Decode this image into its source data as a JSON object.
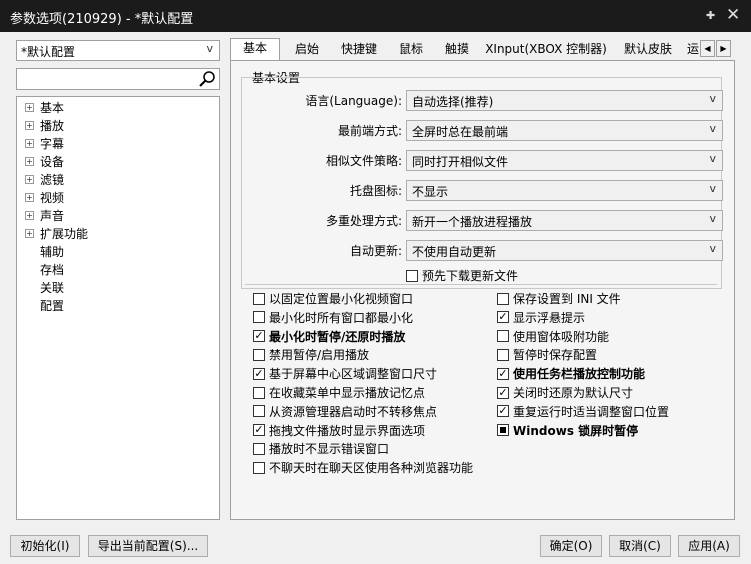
{
  "window": {
    "title": "参数选项(210929) - *默认配置",
    "pin_icon": "pin-icon",
    "close_icon": "close-icon"
  },
  "left_panel": {
    "preset_value": "*默认配置",
    "search_placeholder": "",
    "tree": [
      {
        "label": "基本",
        "expandable": true
      },
      {
        "label": "播放",
        "expandable": true
      },
      {
        "label": "字幕",
        "expandable": true
      },
      {
        "label": "设备",
        "expandable": true
      },
      {
        "label": "滤镜",
        "expandable": true
      },
      {
        "label": "视频",
        "expandable": true
      },
      {
        "label": "声音",
        "expandable": true
      },
      {
        "label": "扩展功能",
        "expandable": true
      },
      {
        "label": "辅助",
        "expandable": false
      },
      {
        "label": "存档",
        "expandable": false
      },
      {
        "label": "关联",
        "expandable": false
      },
      {
        "label": "配置",
        "expandable": false
      }
    ]
  },
  "tabs": [
    "基本",
    "启始",
    "快捷键",
    "鼠标",
    "触摸",
    "XInput(XBOX 控制器)",
    "默认皮肤",
    "运"
  ],
  "active_tab": 0,
  "basic": {
    "group_label": "基本设置",
    "rows": [
      {
        "label": "语言(Language):",
        "value": "自动选择(推荐)"
      },
      {
        "label": "最前端方式:",
        "value": "全屏时总在最前端"
      },
      {
        "label": "相似文件策略:",
        "value": "同时打开相似文件"
      },
      {
        "label": "托盘图标:",
        "value": "不显示"
      },
      {
        "label": "多重处理方式:",
        "value": "新开一个播放进程播放"
      },
      {
        "label": "自动更新:",
        "value": "不使用自动更新"
      }
    ],
    "predownload": {
      "label": "预先下载更新文件",
      "checked": false
    }
  },
  "options_left": [
    {
      "label": "以固定位置最小化视频窗口",
      "checked": false,
      "bold": false
    },
    {
      "label": "最小化时所有窗口都最小化",
      "checked": false,
      "bold": false
    },
    {
      "label": "最小化时暂停/还原时播放",
      "checked": true,
      "bold": true
    },
    {
      "label": "禁用暂停/启用播放",
      "checked": false,
      "bold": false
    },
    {
      "label": "基于屏幕中心区域调整窗口尺寸",
      "checked": true,
      "bold": false
    },
    {
      "label": "在收藏菜单中显示播放记忆点",
      "checked": false,
      "bold": false
    },
    {
      "label": "从资源管理器启动时不转移焦点",
      "checked": false,
      "bold": false
    },
    {
      "label": "拖拽文件播放时显示界面选项",
      "checked": true,
      "bold": false
    },
    {
      "label": "播放时不显示错误窗口",
      "checked": false,
      "bold": false
    },
    {
      "label": "不聊天时在聊天区使用各种浏览器功能",
      "checked": false,
      "bold": false
    }
  ],
  "options_right": [
    {
      "label": "保存设置到 INI 文件",
      "state": "unchecked",
      "bold": false
    },
    {
      "label": "显示浮悬提示",
      "state": "checked",
      "bold": false
    },
    {
      "label": "使用窗体吸附功能",
      "state": "unchecked",
      "bold": false
    },
    {
      "label": "暂停时保存配置",
      "state": "unchecked",
      "bold": false
    },
    {
      "label": "使用任务栏播放控制功能",
      "state": "checked",
      "bold": true
    },
    {
      "label": "关闭时还原为默认尺寸",
      "state": "checked",
      "bold": false
    },
    {
      "label": "重复运行时适当调整窗口位置",
      "state": "checked",
      "bold": false
    },
    {
      "label": "Windows 锁屏时暂停",
      "state": "indeterminate",
      "bold": true
    }
  ],
  "buttons": {
    "init": "初始化(I)",
    "export": "导出当前配置(S)...",
    "ok": "确定(O)",
    "cancel": "取消(C)",
    "apply": "应用(A)"
  }
}
